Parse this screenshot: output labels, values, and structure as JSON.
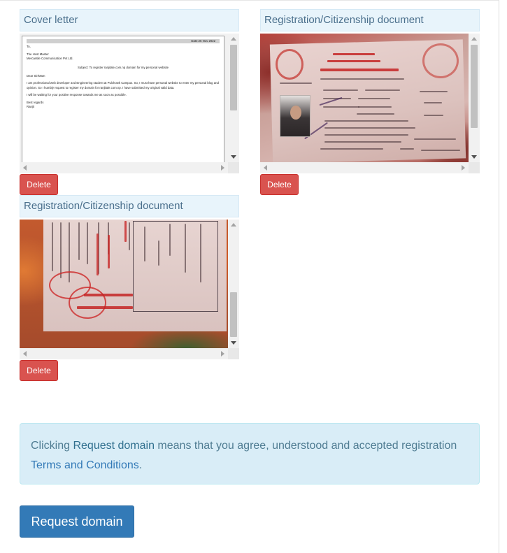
{
  "documents": [
    {
      "title": "Cover letter",
      "delete_label": "Delete",
      "letter": {
        "date": "Date:26 Nov 2022",
        "lines_top": [
          "To,",
          "The Host Master",
          "Mercantile Communication Pvt Ltd."
        ],
        "subject": "Subject: To register ranjitale.com.np domain for my personal website",
        "salutation": "Dear Sir/Mam",
        "body": "I am professional web developer and Engineering student at Pulchowk Campus. So, I must have personal website to enter my personal blog and opinion. So I humbly request to register my domain for ranjitale.com.np. I have submitted my original valid data.",
        "closing": "I will be waiting for your positive response towards me as soon as possible.",
        "regards": "Best regards",
        "signature": "Ranjit"
      },
      "vscroll_thumb": {
        "top_fraction": 0.0,
        "size_fraction": 0.62
      }
    },
    {
      "title": "Registration/Citizenship document",
      "delete_label": "Delete",
      "vscroll_thumb": {
        "top_fraction": 0.0,
        "size_fraction": 0.78
      }
    },
    {
      "title": "Registration/Citizenship document",
      "delete_label": "Delete",
      "vscroll_thumb": {
        "top_fraction": 0.58,
        "size_fraction": 0.42
      }
    }
  ],
  "notice": {
    "prefix": "Clicking ",
    "action": "Request domain",
    "middle": " means that you agree, understood and accepted registration ",
    "terms_link": "Terms and Conditions",
    "suffix": "."
  },
  "submit": {
    "label": "Request domain"
  },
  "colors": {
    "primary": "#337ab7",
    "danger": "#d9534f",
    "info_bg": "#d9edf7",
    "panel_head_bg": "#e8f4fb"
  }
}
